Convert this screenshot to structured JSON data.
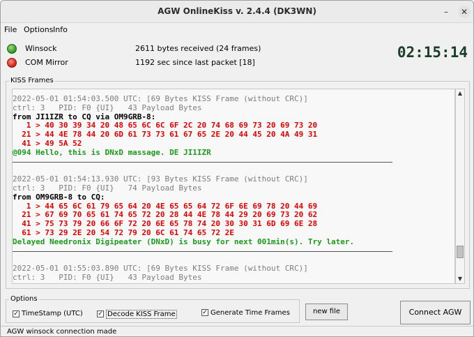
{
  "window": {
    "title": "AGW OnlineKiss v. 2.4.4  (DK3WN)"
  },
  "menu": [
    "File",
    "Options",
    "Info"
  ],
  "status": {
    "winsock": {
      "label": "Winsock",
      "detail": "2611 bytes received (24 frames)",
      "color": "#2d8f22"
    },
    "com": {
      "label": "COM Mirror",
      "detail": "1192 sec since last packet [18]",
      "color": "#cc2010"
    },
    "clock": "02:15:14"
  },
  "kiss": {
    "label": "KISS Frames",
    "lines": [
      {
        "t": "2022-05-01 01:54:03.500 UTC: [69 Bytes KISS Frame (without CRC)]",
        "c": "gray"
      },
      {
        "t": "ctrl: 3   PID: F0 {UI}   43 Payload Bytes",
        "c": "gray"
      },
      {
        "t": "from JI1IZR to CQ via OM9GRB-8:",
        "c": "black"
      },
      {
        "t": "   1 > 40 30 39 34 20 48 65 6C 6C 6F 2C 20 74 68 69 73 20 69 73 20",
        "c": "red"
      },
      {
        "t": "  21 > 44 4E 78 44 20 6D 61 73 73 61 67 65 2E 20 44 45 20 4A 49 31",
        "c": "red"
      },
      {
        "t": "  41 > 49 5A 52",
        "c": "red"
      },
      {
        "t": "@094 Hello, this is DNxD massage. DE JI1IZR",
        "c": "green"
      },
      {
        "t": "",
        "c": "sep"
      },
      {
        "t": "",
        "c": "blank"
      },
      {
        "t": "2022-05-01 01:54:13.930 UTC: [93 Bytes KISS Frame (without CRC)]",
        "c": "gray"
      },
      {
        "t": "ctrl: 3   PID: F0 {UI}   74 Payload Bytes",
        "c": "gray"
      },
      {
        "t": "from OM9GRB-8 to CQ:",
        "c": "black"
      },
      {
        "t": "   1 > 44 65 6C 61 79 65 64 20 4E 65 65 64 72 6F 6E 69 78 20 44 69",
        "c": "red"
      },
      {
        "t": "  21 > 67 69 70 65 61 74 65 72 20 28 44 4E 78 44 29 20 69 73 20 62",
        "c": "red"
      },
      {
        "t": "  41 > 75 73 79 20 66 6F 72 20 6E 65 78 74 20 30 30 31 6D 69 6E 28",
        "c": "red"
      },
      {
        "t": "  61 > 73 29 2E 20 54 72 79 20 6C 61 74 65 72 2E",
        "c": "red"
      },
      {
        "t": "Delayed Needronix Digipeater (DNxD) is busy for next 001min(s). Try later.",
        "c": "green"
      },
      {
        "t": "",
        "c": "sep"
      },
      {
        "t": "",
        "c": "blank"
      },
      {
        "t": "2022-05-01 01:55:03.890 UTC: [69 Bytes KISS Frame (without CRC)]",
        "c": "gray"
      },
      {
        "t": "ctrl: 3   PID: F0 {UI}   43 Payload Bytes",
        "c": "gray"
      }
    ]
  },
  "options": {
    "label": "Options",
    "timestamp": {
      "label": "TimeStamp (UTC)",
      "checked": true
    },
    "decode": {
      "label": "Decode KISS Frame",
      "checked": true
    },
    "generate": {
      "label": "Generate Time Frames",
      "checked": true
    },
    "new_file": "new file",
    "connect": "Connect AGW"
  },
  "statusbar": {
    "text": "AGW winsock connection made"
  },
  "icons": {
    "minimize": "minimize-icon",
    "close": "close-icon",
    "scroll_up": "arrow-up-icon",
    "scroll_down": "arrow-down-icon",
    "check": "check-icon"
  }
}
